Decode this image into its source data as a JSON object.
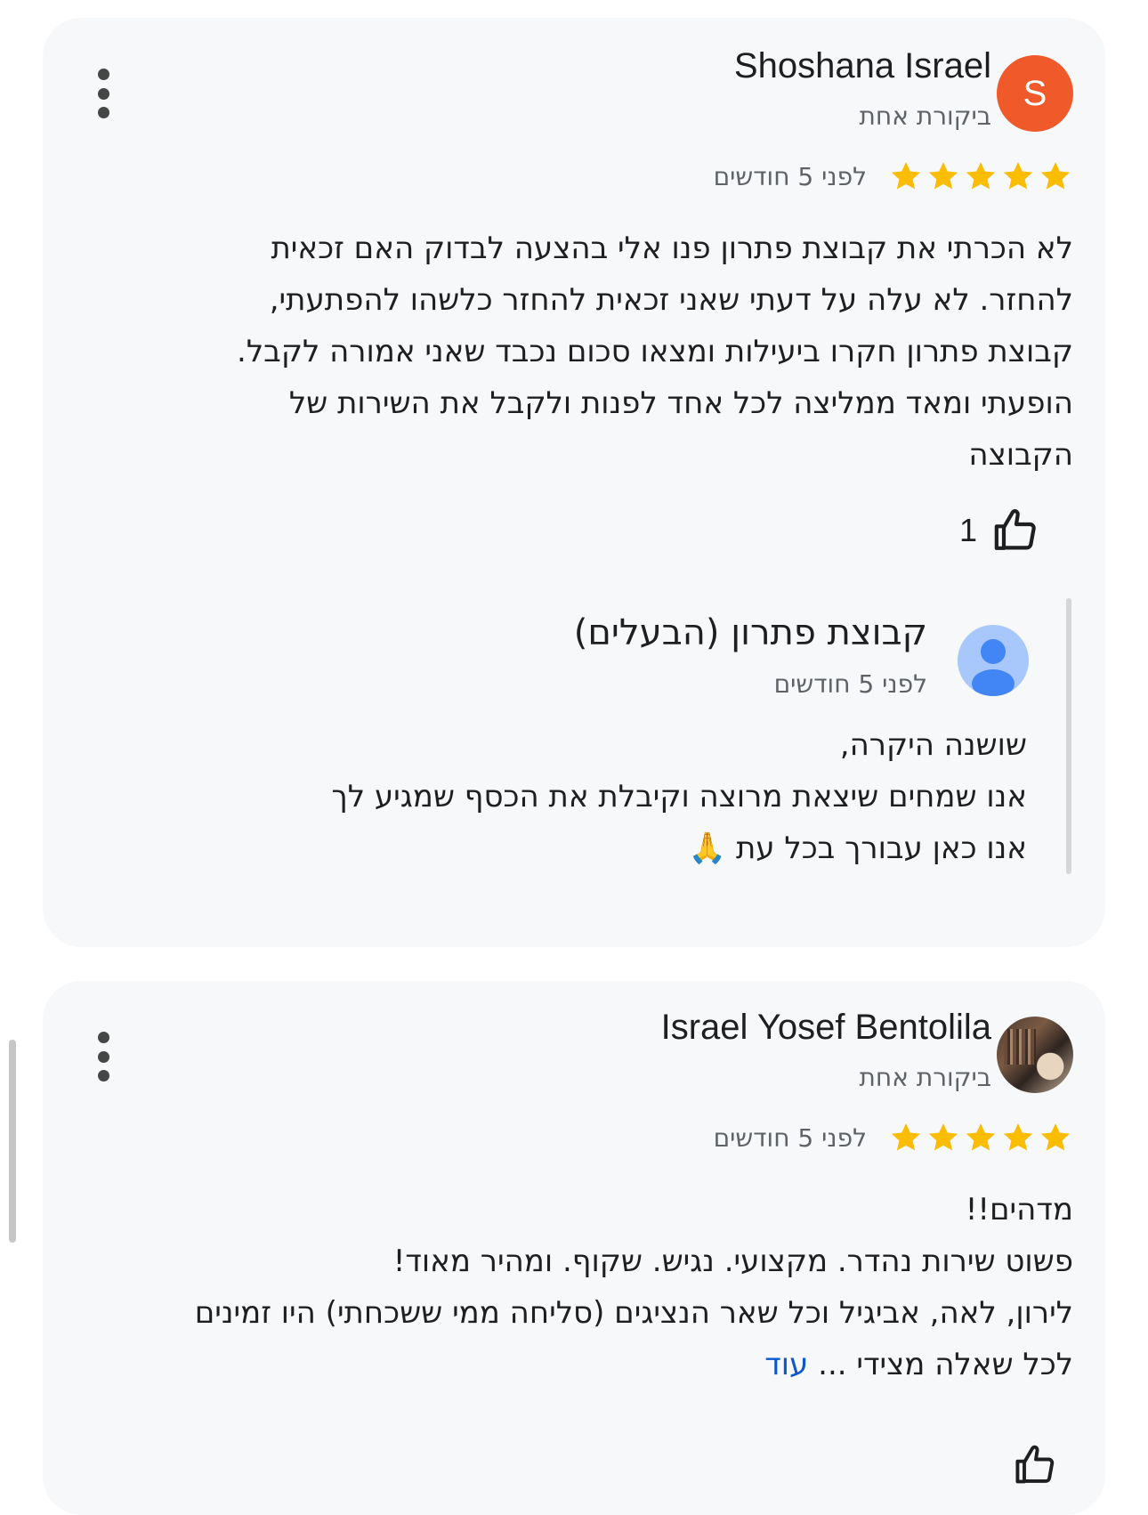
{
  "reviews": [
    {
      "reviewer_name": "Shoshana Israel",
      "avatar_letter": "S",
      "avatar_color": "#f0592a",
      "review_count": "ביקורת אחת",
      "rating": 5,
      "time_ago": "לפני 5 חודשים",
      "text_lines": [
        "לא הכרתי את קבוצת פתרון פנו אלי בהצעה לבדוק האם זכאית",
        "להחזר. לא עלה על דעתי שאני זכאית להחזר כלשהו להפתעתי,",
        "קבוצת פתרון חקרו ביעילות ומצאו סכום נכבד שאני אמורה לקבל.",
        "הופעתי ומאד ממליצה לכל אחד לפנות ולקבל את השירות של",
        "הקבוצה"
      ],
      "like_count": "1",
      "owner_reply": {
        "owner_name": "קבוצת פתרון (הבעלים)",
        "time_ago": "לפני 5 חודשים",
        "lines": [
          "שושנה היקרה,",
          "אנו שמחים שיצאת מרוצה וקיבלת את הכסף שמגיע לך",
          "אנו כאן עבורך בכל עת 🙏"
        ]
      }
    },
    {
      "reviewer_name": "Israel Yosef Bentolila",
      "review_count": "ביקורת אחת",
      "rating": 5,
      "time_ago": "לפני 5 חודשים",
      "text_lines": [
        "מדהים!!",
        "פשוט שירות נהדר. מקצועי. נגיש. שקוף. ומהיר מאוד!",
        "לירון, לאה, אביגיל וכל שאר הנציגים (סליחה ממי ששכחתי) היו זמינים",
        "לכל שאלה מצידי ..."
      ],
      "more_label": "עוד"
    }
  ],
  "colors": {
    "star": "#fbbc04",
    "card_bg": "#f7f8fa",
    "link": "#0b57d0",
    "secondary_text": "#5f6368"
  },
  "icons": [
    "more-vert-icon",
    "star-icon",
    "thumb-up-icon",
    "person-icon"
  ]
}
